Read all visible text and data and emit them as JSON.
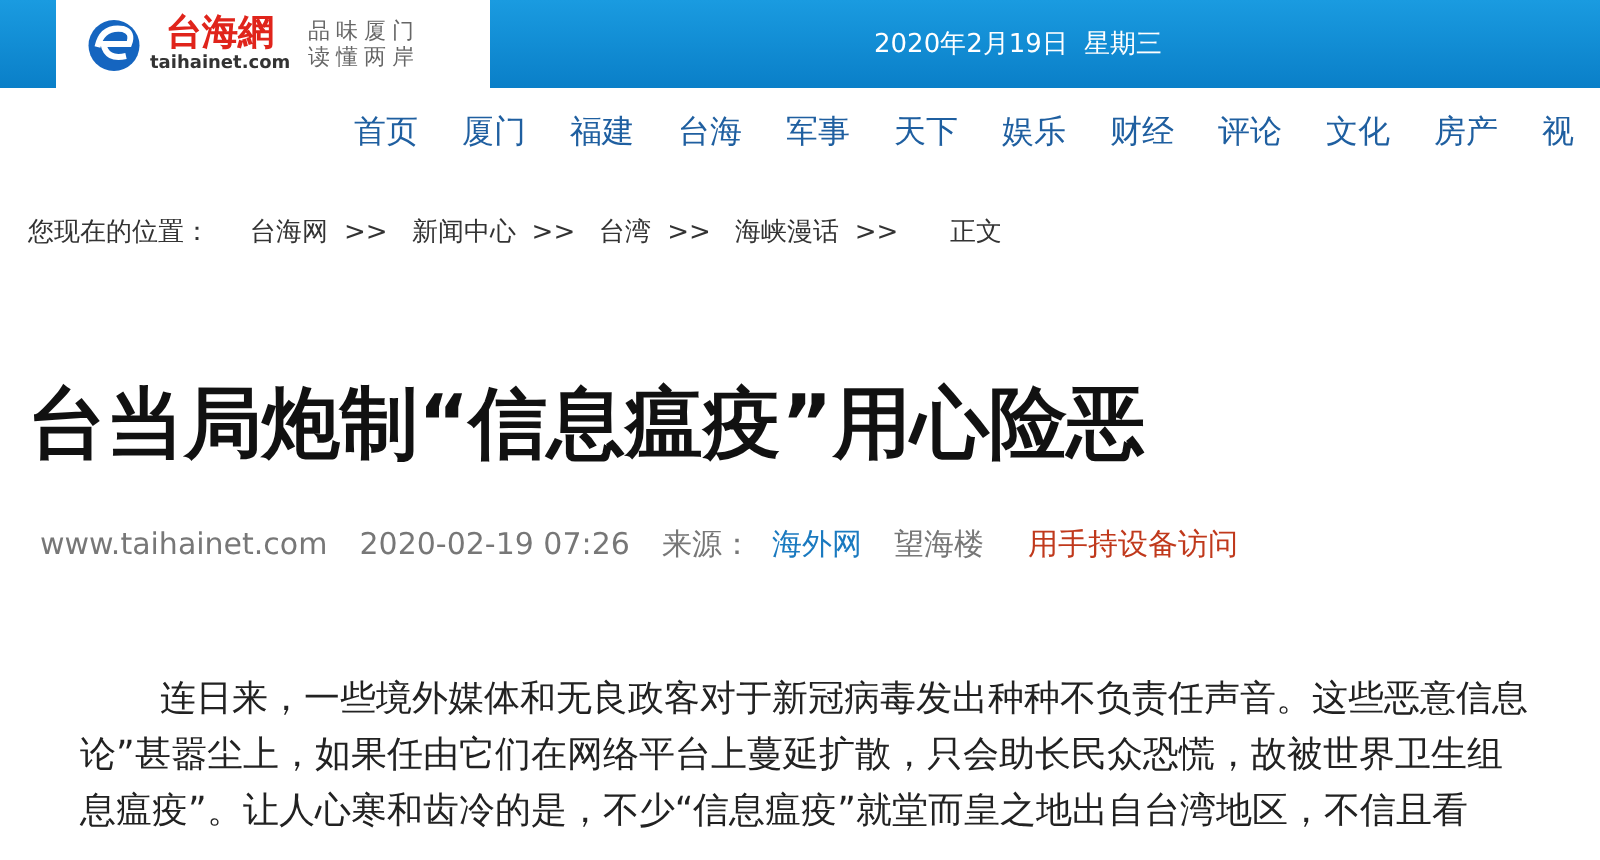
{
  "header": {
    "logo": {
      "name": "台海網",
      "domain": "taihainet.com",
      "slogan_1": "品味厦门",
      "slogan_2": "读懂两岸"
    },
    "date": "2020年2月19日  星期三"
  },
  "nav": [
    "首页",
    "厦门",
    "福建",
    "台海",
    "军事",
    "天下",
    "娱乐",
    "财经",
    "评论",
    "文化",
    "房产",
    "视"
  ],
  "breadcrumb": {
    "label": "您现在的位置：",
    "items": [
      "台海网",
      "新闻中心",
      "台湾",
      "海峡漫话",
      "正文"
    ],
    "separator": ">>"
  },
  "article": {
    "title": "台当局炮制“信息瘟疫”用心险恶",
    "meta": {
      "site": "www.taihainet.com",
      "datetime": "2020-02-19 07:26",
      "source_label": "来源：",
      "source": "海外网",
      "author": "望海楼",
      "mobile_link": "用手持设备访问"
    },
    "body_lines": [
      "连日来，一些境外媒体和无良政客对于新冠病毒发出种种不负责任声音。这些恶意信息",
      "论”甚嚣尘上，如果任由它们在网络平台上蔓延扩散，只会助长民众恐慌，故被世界卫生组",
      "息瘟疫”。让人心寒和齿冷的是，不少“信息瘟疫”就堂而皇之地出自台湾地区，不信且看"
    ]
  }
}
